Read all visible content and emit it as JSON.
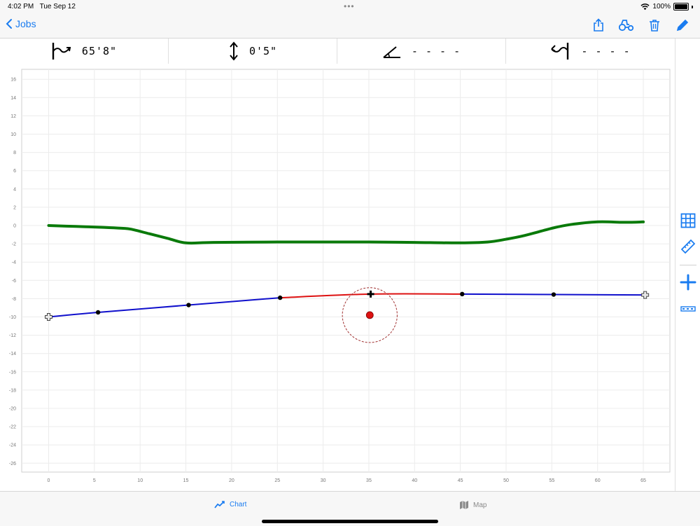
{
  "status": {
    "time": "4:02 PM",
    "date": "Tue Sep 12",
    "battery": "100%"
  },
  "nav": {
    "back_label": "Jobs",
    "actions": [
      "share-icon",
      "tractor-icon",
      "trash-icon",
      "pencil-icon"
    ]
  },
  "measurements": [
    {
      "icon": "length-icon",
      "value": "65'8\""
    },
    {
      "icon": "depth-icon",
      "value": "0'5\""
    },
    {
      "icon": "angle-icon",
      "value": "- - - -"
    },
    {
      "icon": "offset-icon",
      "value": "- - - -"
    }
  ],
  "tools": [
    "grid-icon",
    "ruler-icon",
    "plus-icon",
    "dashed-line-icon"
  ],
  "tabs": [
    {
      "label": "Chart",
      "icon": "chart-icon",
      "selected": true
    },
    {
      "label": "Map",
      "icon": "map-icon",
      "selected": false
    }
  ],
  "colors": {
    "accent": "#1a7cf0",
    "ground_line": "#0a7a0a",
    "bore_line": "#1010cc",
    "bore_highlight": "#dd1111",
    "target": "#dd1111"
  },
  "chart_data": {
    "type": "line",
    "xlim": [
      -3,
      68
    ],
    "ylim": [
      -27,
      17
    ],
    "x_ticks": [
      0,
      5,
      10,
      15,
      20,
      25,
      30,
      35,
      40,
      45,
      50,
      55,
      60,
      65
    ],
    "y_ticks": [
      16,
      14,
      12,
      10,
      8,
      6,
      4,
      2,
      0,
      -2,
      -4,
      -6,
      -8,
      -10,
      -12,
      -14,
      -16,
      -18,
      -20,
      -22,
      -24,
      -26
    ],
    "grid": true,
    "series": [
      {
        "role": "ground",
        "points": [
          [
            0,
            0
          ],
          [
            3,
            -0.1
          ],
          [
            6,
            -0.2
          ],
          [
            8,
            -0.3
          ],
          [
            9,
            -0.4
          ],
          [
            11,
            -0.9
          ],
          [
            13,
            -1.4
          ],
          [
            15,
            -1.9
          ],
          [
            18,
            -1.85
          ],
          [
            25,
            -1.8
          ],
          [
            30,
            -1.8
          ],
          [
            35,
            -1.8
          ],
          [
            40,
            -1.85
          ],
          [
            45,
            -1.9
          ],
          [
            48,
            -1.8
          ],
          [
            50,
            -1.5
          ],
          [
            52,
            -1.1
          ],
          [
            55,
            -0.3
          ],
          [
            57,
            0.1
          ],
          [
            60,
            0.4
          ],
          [
            63,
            0.35
          ],
          [
            65,
            0.4
          ]
        ]
      },
      {
        "role": "bore",
        "points": [
          [
            0,
            -10
          ],
          [
            5.4,
            -9.5
          ],
          [
            15.3,
            -8.7
          ],
          [
            25.3,
            -7.9
          ],
          [
            35.2,
            -7.5
          ],
          [
            45.2,
            -7.5
          ],
          [
            55.2,
            -7.55
          ],
          [
            65.2,
            -7.6
          ]
        ]
      }
    ],
    "highlight_range": [
      25.3,
      45.2
    ],
    "nodes": [
      [
        5.4,
        -9.5
      ],
      [
        15.3,
        -8.7
      ],
      [
        25.3,
        -7.9
      ],
      [
        45.2,
        -7.5
      ],
      [
        55.2,
        -7.55
      ]
    ],
    "endpoints": [
      [
        0,
        -10
      ],
      [
        65.2,
        -7.6
      ]
    ],
    "cursor": [
      35.2,
      -7.5
    ],
    "target": {
      "center": [
        35.1,
        -9.8
      ],
      "radius": 3
    }
  }
}
